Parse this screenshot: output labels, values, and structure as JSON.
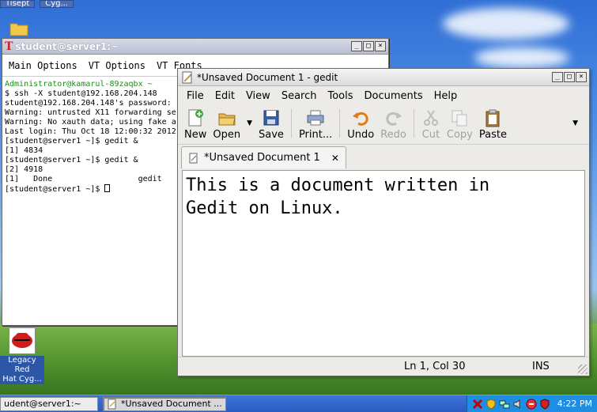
{
  "desktop": {
    "top_taskbar_items": [
      "Tisept",
      "Cyg..."
    ],
    "icon_label_lines": [
      "Legacy Red",
      "Hat Cyg..."
    ]
  },
  "terminal": {
    "title": "student@server1:~",
    "menu": [
      "Main Options",
      "VT Options",
      "VT Fonts"
    ],
    "lines": [
      "Administrator@kamarul-89zaqbx ~",
      "$ ssh -X student@192.168.204.148",
      "student@192.168.204.148's password:",
      "Warning: untrusted X11 forwarding se",
      "Warning: No xauth data; using fake a",
      "Last login: Thu Oct 18 12:00:32 2012",
      "[student@server1 ~]$ gedit &",
      "[1] 4834",
      "[student@server1 ~]$ gedit &",
      "[2] 4918",
      "[1]   Done                  gedit",
      "[student@server1 ~]$ "
    ]
  },
  "gedit": {
    "title": "*Unsaved Document 1 - gedit",
    "menu": [
      "File",
      "Edit",
      "View",
      "Search",
      "Tools",
      "Documents",
      "Help"
    ],
    "toolbar": {
      "new": "New",
      "open": "Open",
      "save": "Save",
      "print": "Print...",
      "undo": "Undo",
      "redo": "Redo",
      "cut": "Cut",
      "copy": "Copy",
      "paste": "Paste"
    },
    "tab_label": "*Unsaved Document 1",
    "content": "This is a document written in\nGedit on Linux.",
    "status": {
      "position": "Ln 1, Col 30",
      "mode": "INS"
    }
  },
  "taskbar": {
    "items": [
      "udent@server1:~",
      "*Unsaved Document ..."
    ],
    "clock": "4:22 PM"
  },
  "colors": {
    "taskbar": "#2a5bc0",
    "tray": "#1e8ee4",
    "prompt_green": "#1a8f1a"
  }
}
